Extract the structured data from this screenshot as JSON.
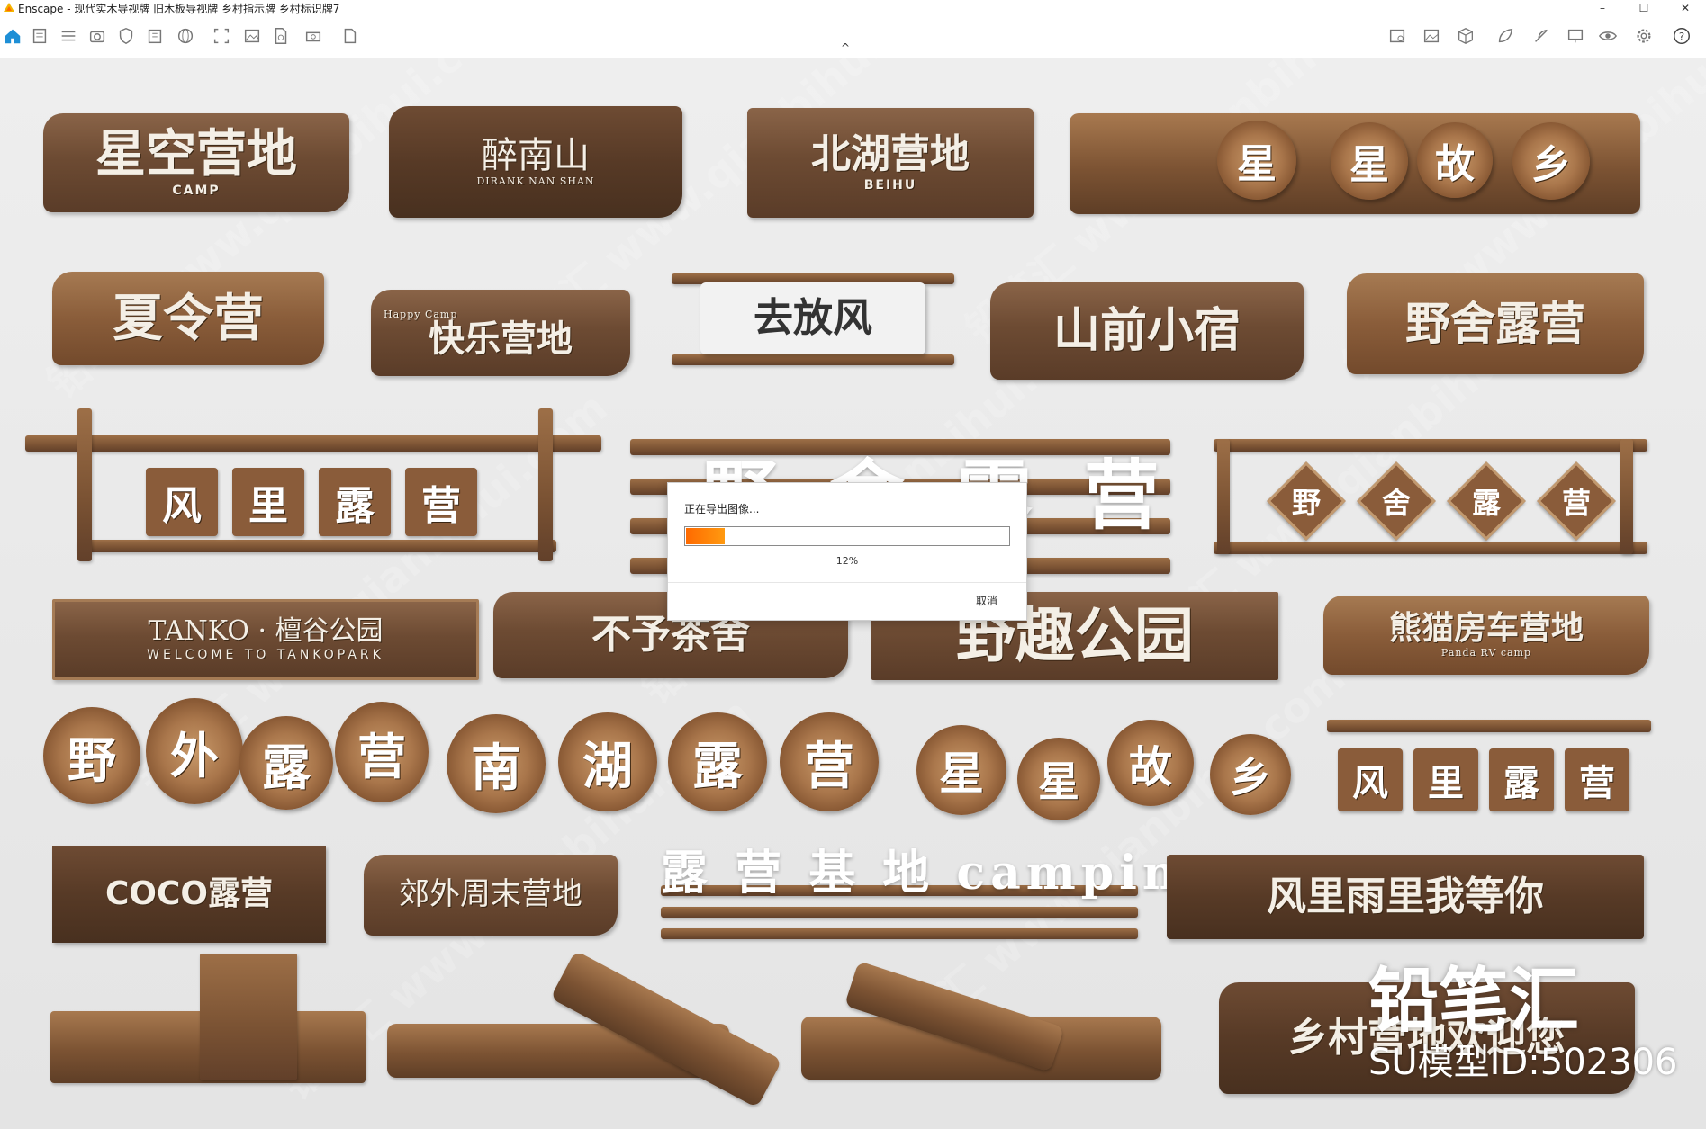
{
  "window": {
    "title": "Enscape - 现代实木导视牌 旧木板导视牌 乡村指示牌 乡村标识牌7",
    "minimize": "–",
    "maximize": "☐",
    "close": "✕"
  },
  "viewport": {
    "caret": "^",
    "signs": {
      "s1": {
        "text": "星空营地",
        "sub": "CAMP"
      },
      "s2": {
        "text": "醉南山",
        "sub": "DIRANK NAN SHAN"
      },
      "s3": {
        "text": "北湖营地",
        "sub": "BEIHU"
      },
      "s4": [
        "星",
        "星",
        "故",
        "乡"
      ],
      "s5": {
        "text": "夏令营"
      },
      "s6": {
        "text": "快乐营地",
        "sub": "Happy Camp"
      },
      "s7": {
        "text": "去放风"
      },
      "s8": {
        "text": "山前小宿"
      },
      "s9": {
        "text": "野舍露营"
      },
      "s10": [
        "风",
        "里",
        "露",
        "营"
      ],
      "s11_ghost": "野 舍 露 营",
      "s12": [
        "野",
        "舍",
        "露",
        "营"
      ],
      "s13": {
        "text": "TANKO · 檀谷公园",
        "sub": "WELCOME TO TANKOPARK"
      },
      "s14": {
        "text": "不予茶舍"
      },
      "s15": {
        "text": "野趣公园"
      },
      "s16": {
        "text": "熊猫房车营地",
        "sub": "Panda RV camp"
      },
      "s17": [
        "野",
        "外",
        "露",
        "营"
      ],
      "s18": [
        "南",
        "湖",
        "露",
        "营"
      ],
      "s19": [
        "星",
        "星",
        "故",
        "乡"
      ],
      "s20": [
        "风",
        "里",
        "露",
        "营"
      ],
      "s21": {
        "text": "COCO露营"
      },
      "s22": {
        "text": "郊外周末营地"
      },
      "s23_ghost": "露 营 基 地 camping",
      "s24": {
        "text": "风里雨里我等你"
      },
      "s25": {
        "text": "乡村营地欢迎您"
      }
    },
    "watermark": "铅笔汇 www.qianbihui.com",
    "brand": "铅笔汇",
    "model_id": "SU模型ID:502306"
  },
  "export_dialog": {
    "label": "正在导出图像...",
    "progress": 0.12,
    "progress_text": "12%",
    "cancel": "取消"
  },
  "colors": {
    "progress_fill": "#ff7a00",
    "wood": "#6d4b33",
    "accent_home": "#1e8fd6"
  }
}
